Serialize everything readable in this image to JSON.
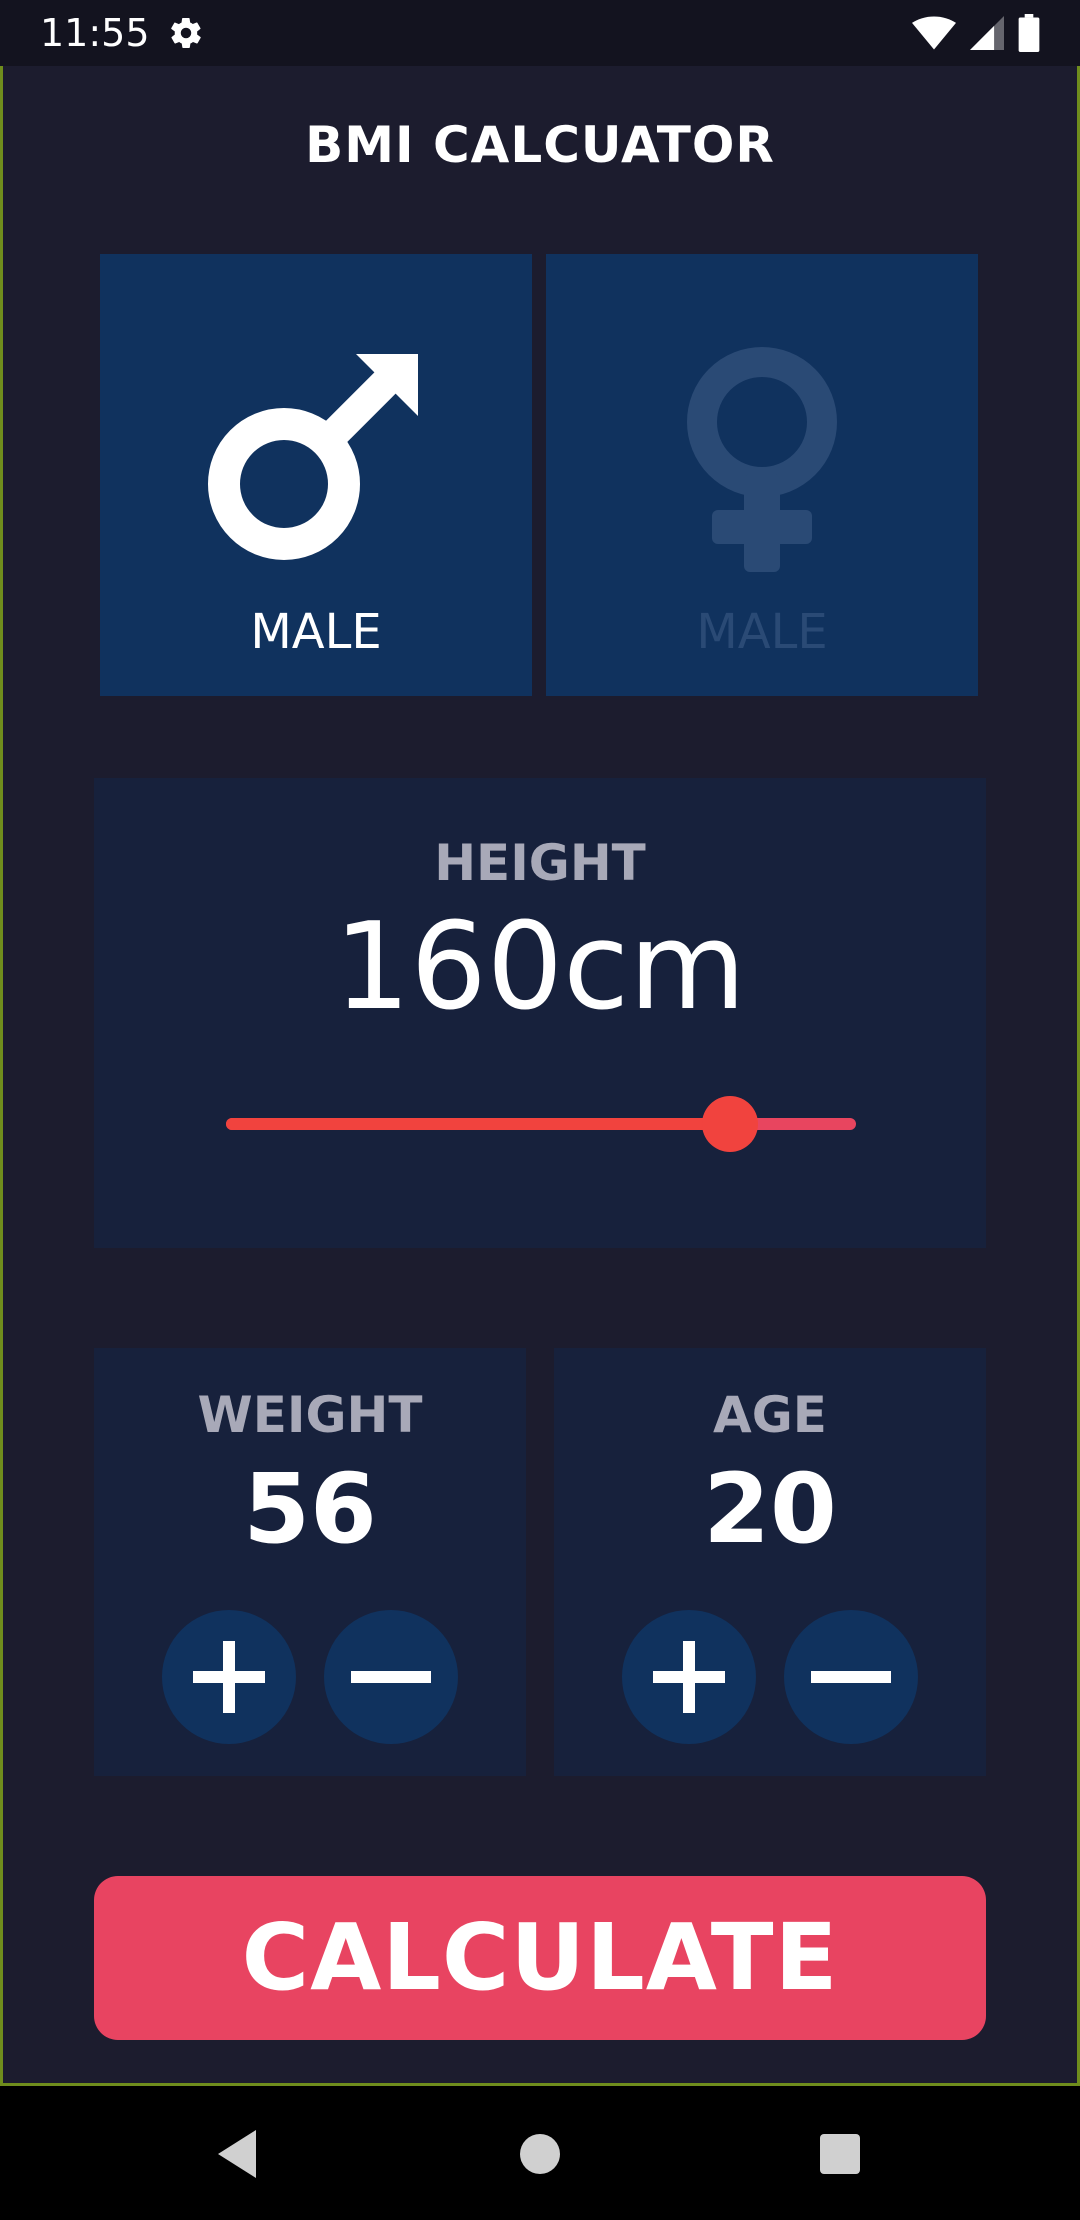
{
  "status_bar": {
    "time": "11:55"
  },
  "app": {
    "title": "BMI CALCUATOR",
    "gender": {
      "male_label": "MALE",
      "female_label": "MALE",
      "selected": "male"
    },
    "height": {
      "label": "HEIGHT",
      "value_text": "160cm",
      "slider_fraction": 0.8
    },
    "weight": {
      "label": "WEIGHT",
      "value": "56"
    },
    "age": {
      "label": "AGE",
      "value": "20"
    },
    "calculate_label": "CALCULATE"
  },
  "colors": {
    "background": "#1c1c2e",
    "card": "#17213c",
    "gender_card": "#10325e",
    "accent": "#e84461",
    "slider": "#f1433e"
  },
  "icons": [
    "gear-icon",
    "wifi-icon",
    "signal-icon",
    "battery-icon",
    "male-icon",
    "female-icon",
    "plus-icon",
    "minus-icon",
    "back-icon",
    "home-icon",
    "recents-icon"
  ]
}
